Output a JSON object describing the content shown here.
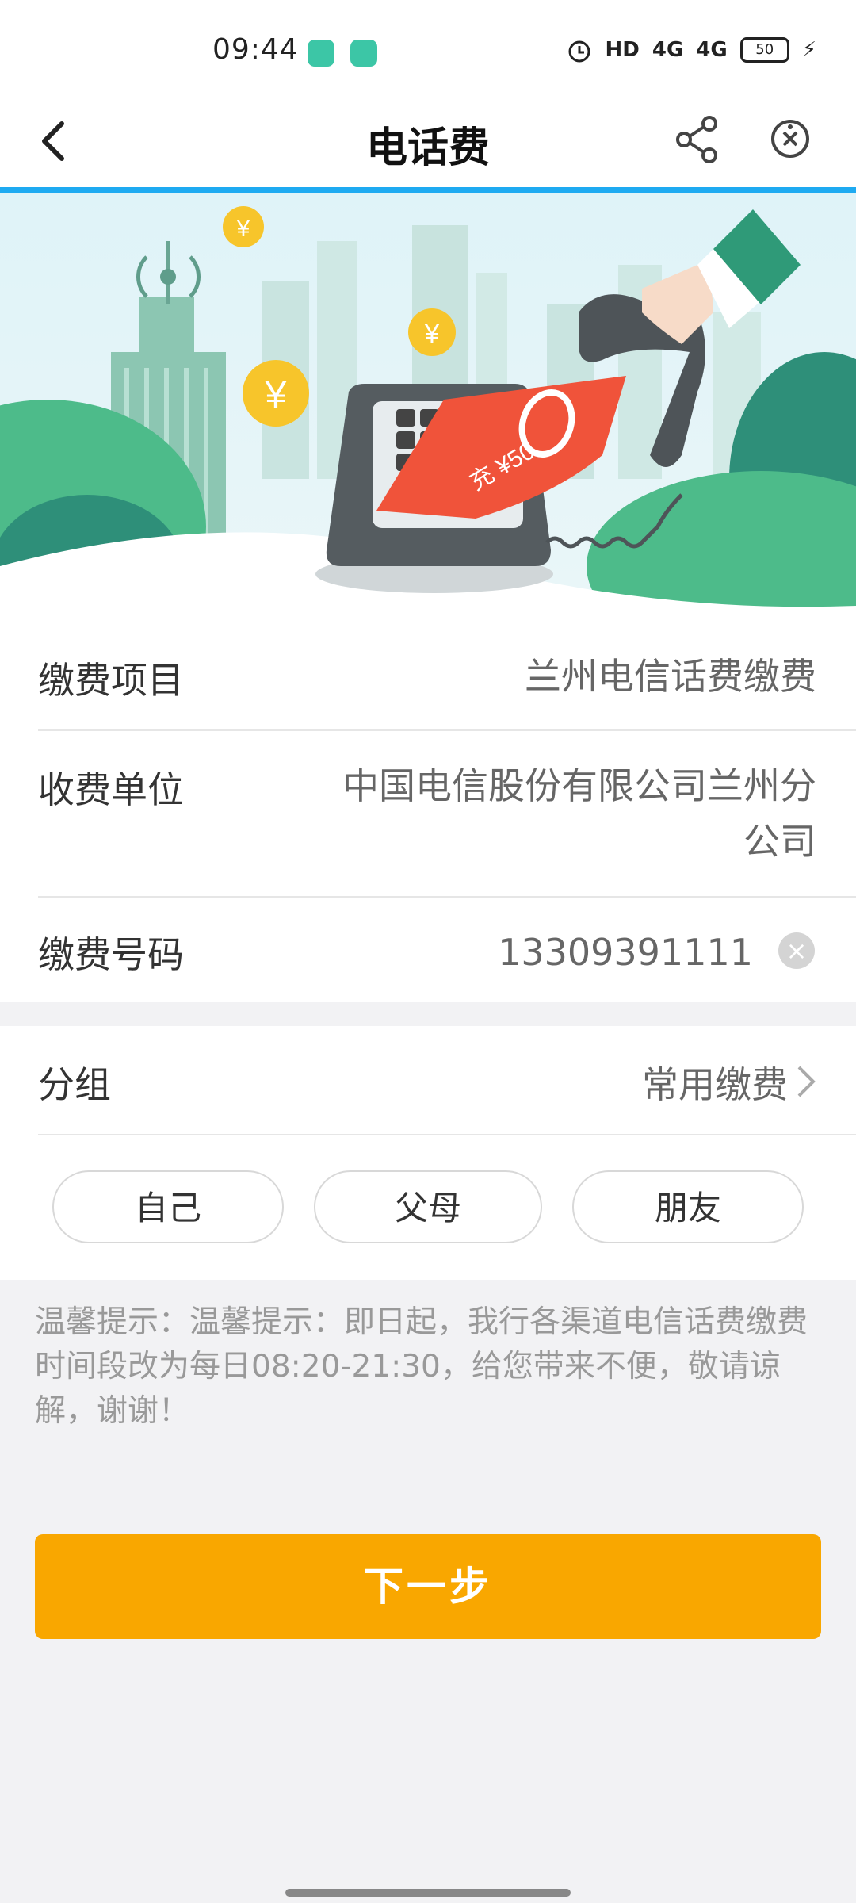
{
  "status_bar": {
    "time": "09:44",
    "indicators": [
      "alarm-icon",
      "HD",
      "4G",
      "4G"
    ],
    "hd": "HD",
    "net1": "4G",
    "net2": "4G",
    "battery": "50"
  },
  "nav": {
    "title": "电话费"
  },
  "form": {
    "item_label": "缴费项目",
    "item_value": "兰州电信话费缴费",
    "payee_label": "收费单位",
    "payee_value": "中国电信股份有限公司兰州分公司",
    "number_label": "缴费号码",
    "number_value": "13309391111"
  },
  "group": {
    "label": "分组",
    "value": "常用缴费",
    "chips": [
      "自己",
      "父母",
      "朋友"
    ]
  },
  "tip": "温馨提示：温馨提示：即日起，我行各渠道电信话费缴费时间段改为每日08:20-21:30，给您带来不便，敬请谅解，谢谢！",
  "next_button": "下一步",
  "banner": {
    "recharge_text": "充 ¥50"
  },
  "colors": {
    "accent_line": "#1eaaf1",
    "button": "#f9a700"
  }
}
